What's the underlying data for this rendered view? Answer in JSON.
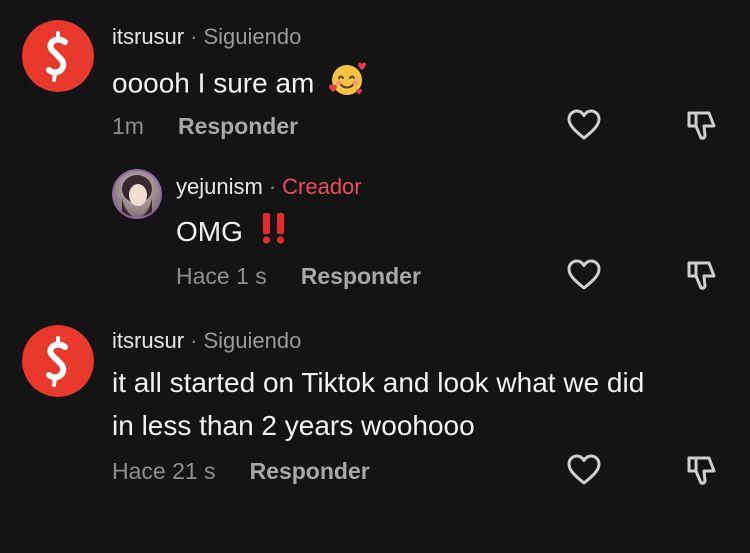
{
  "comments": [
    {
      "username": "itsrusur",
      "status": "Siguiendo",
      "text": "ooooh I sure am",
      "emoji_icon": "smiling-face-with-hearts-emoji",
      "time": "1m",
      "reply_label": "Responder"
    },
    {
      "username": "yejunism",
      "status": "Creador",
      "text": "OMG",
      "emoji_icon": "double-exclamation-mark-emoji",
      "time": "Hace 1 s",
      "reply_label": "Responder"
    },
    {
      "username": "itsrusur",
      "status": "Siguiendo",
      "text_line1": "it all started on Tiktok and look what we did",
      "text_line2": "in less than 2 years woohooo",
      "time": "Hace 21 s",
      "reply_label": "Responder"
    }
  ],
  "colors": {
    "background": "#141414",
    "avatar_red": "#e8392c",
    "creator_accent": "#f04a62"
  },
  "icons": {
    "like": "heart-outline-icon",
    "dislike": "thumbs-down-outline-icon"
  }
}
